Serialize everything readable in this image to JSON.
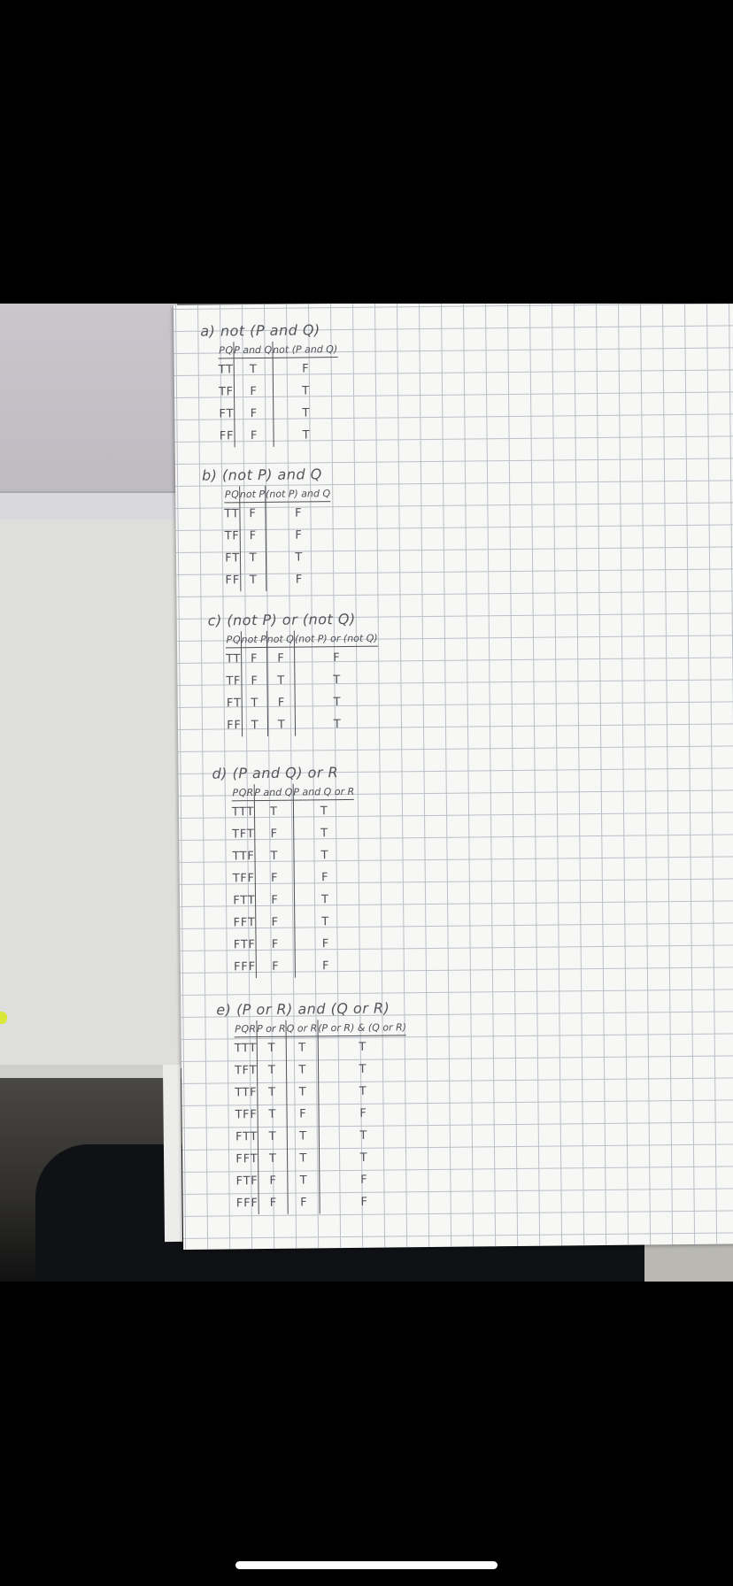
{
  "homework": [
    {
      "id": "a",
      "title": "a) not (P and Q)",
      "headers": [
        "P",
        "Q",
        "P and Q",
        "not (P and Q)"
      ],
      "rows": [
        [
          "T",
          "T",
          "T",
          "F"
        ],
        [
          "T",
          "F",
          "F",
          "T"
        ],
        [
          "F",
          "T",
          "F",
          "T"
        ],
        [
          "F",
          "F",
          "F",
          "T"
        ]
      ]
    },
    {
      "id": "b",
      "title": "b) (not P) and Q",
      "headers": [
        "P",
        "Q",
        "not P",
        "(not P) and Q"
      ],
      "rows": [
        [
          "T",
          "T",
          "F",
          "F"
        ],
        [
          "T",
          "F",
          "F",
          "F"
        ],
        [
          "F",
          "T",
          "T",
          "T"
        ],
        [
          "F",
          "F",
          "T",
          "F"
        ]
      ]
    },
    {
      "id": "c",
      "title": "c) (not P) or (not Q)",
      "headers": [
        "P",
        "Q",
        "not P",
        "not Q",
        "(not P) or (not Q)"
      ],
      "rows": [
        [
          "T",
          "T",
          "F",
          "F",
          "F"
        ],
        [
          "T",
          "F",
          "F",
          "T",
          "T"
        ],
        [
          "F",
          "T",
          "T",
          "F",
          "T"
        ],
        [
          "F",
          "F",
          "T",
          "T",
          "T"
        ]
      ]
    },
    {
      "id": "d",
      "title": "d) (P and Q) or R",
      "headers": [
        "P",
        "Q",
        "R",
        "P and Q",
        "P and Q or R"
      ],
      "rows": [
        [
          "T",
          "T",
          "T",
          "T",
          "T"
        ],
        [
          "T",
          "F",
          "T",
          "F",
          "T"
        ],
        [
          "T",
          "T",
          "F",
          "T",
          "T"
        ],
        [
          "T",
          "F",
          "F",
          "F",
          "F"
        ],
        [
          "F",
          "T",
          "T",
          "F",
          "T"
        ],
        [
          "F",
          "F",
          "T",
          "F",
          "T"
        ],
        [
          "F",
          "T",
          "F",
          "F",
          "F"
        ],
        [
          "F",
          "F",
          "F",
          "F",
          "F"
        ]
      ]
    },
    {
      "id": "e",
      "title": "e) (P or R) and (Q or R)",
      "headers": [
        "P",
        "Q",
        "R",
        "P or R",
        "Q or R",
        "(P or R) & (Q or R)"
      ],
      "rows": [
        [
          "T",
          "T",
          "T",
          "T",
          "T",
          "T"
        ],
        [
          "T",
          "F",
          "T",
          "T",
          "T",
          "T"
        ],
        [
          "T",
          "T",
          "F",
          "T",
          "T",
          "T"
        ],
        [
          "T",
          "F",
          "F",
          "T",
          "F",
          "F"
        ],
        [
          "F",
          "T",
          "T",
          "T",
          "T",
          "T"
        ],
        [
          "F",
          "F",
          "T",
          "T",
          "T",
          "T"
        ],
        [
          "F",
          "T",
          "F",
          "F",
          "T",
          "F"
        ],
        [
          "F",
          "F",
          "F",
          "F",
          "F",
          "F"
        ]
      ]
    }
  ]
}
